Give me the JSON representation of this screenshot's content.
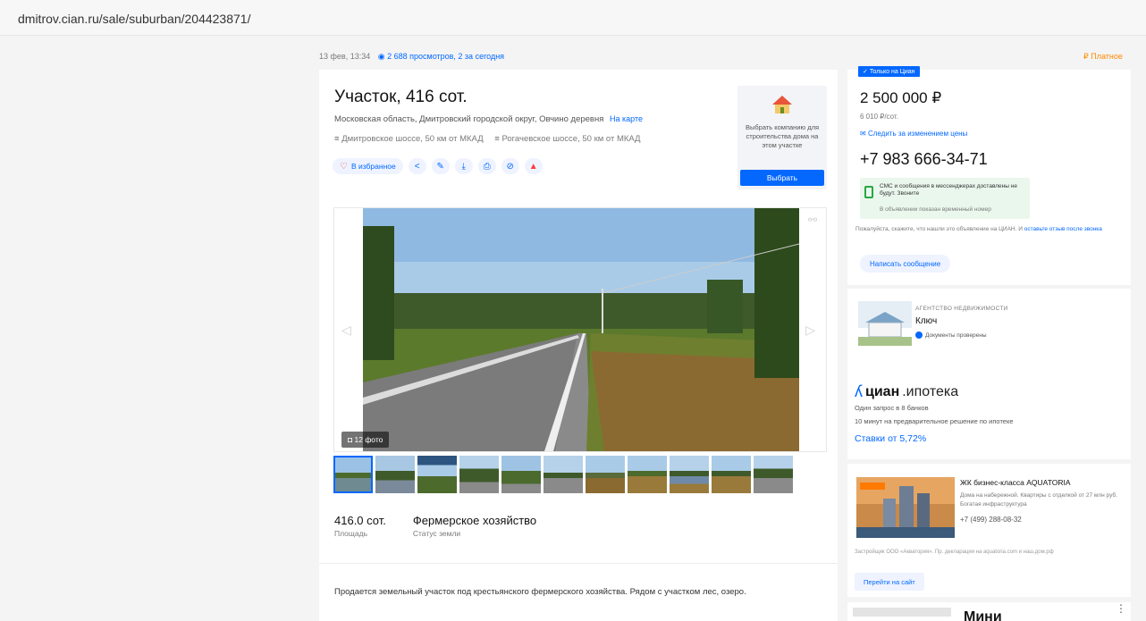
{
  "browser": {
    "url": "dmitrov.cian.ru/sale/suburban/204423871/"
  },
  "meta": {
    "date": "13 фев, 13:34",
    "views": "2 688 просмотров, 2 за сегодня",
    "paid": "₽ Платное"
  },
  "listing": {
    "title": "Участок, 416 сот.",
    "address": "Московская область, Дмитровский городской округ, Овчино деревня",
    "map_link": "На карте",
    "highways": [
      "Дмитровское шоссе, 50 км от МКАД",
      "Рогачевское шоссе, 50 км от МКАД"
    ],
    "favorite_label": "В избранное",
    "action_icons": [
      "share-icon",
      "edit-icon",
      "download-icon",
      "print-icon",
      "hide-icon",
      "report-icon"
    ],
    "builder": {
      "text": "Выбрать компанию для строительства дома на этом участке",
      "button": "Выбрать"
    },
    "photo_count": "12 фото",
    "facts": [
      {
        "value": "416.0 сот.",
        "label": "Площадь"
      },
      {
        "value": "Фермерское хозяйство",
        "label": "Статус земли"
      }
    ],
    "description": "Продается земельный участок под крестьянского фермерского хозяйства. Рядом с участком лес, озеро."
  },
  "offer": {
    "badge": "Только на Циан",
    "price": "2 500 000 ₽",
    "price_per_unit": "6 010 ₽/сот.",
    "follow_price": "Следить за изменением цены",
    "phone": "+7 983 666-34-71",
    "sms_note": "СМС и сообщения в мессенджерах доставлены не будут. Звоните",
    "temp_number_note": "В объявлении показан временный номер",
    "cian_note": "Пожалуйста, скажите, что нашли это объявление на ЦИАН. И",
    "cian_note_link": "оставьте отзыв после звонка",
    "message_button": "Написать сообщение"
  },
  "agency": {
    "type": "АГЕНТСТВО НЕДВИЖИМОСТИ",
    "name": "Ключ",
    "verified": "Документы проверены"
  },
  "mortgage": {
    "logo_bold": "циан",
    "logo_rest": ".ипотека",
    "line1": "Один запрос в 8 банков",
    "line2": "10 минут на предварительное решение по ипотеке",
    "rates": "Ставки от 5,72%"
  },
  "ad": {
    "title": "ЖК бизнес-класса AQUATORIA",
    "desc": "Дома на набережной. Квартиры с отделкой от 27 млн руб. Богатая инфраструктура",
    "phone": "+7 (499) 288-08-32",
    "footer": "Застройщик ООО «Акватория». Пр. декларация на aquatoria.com и наш.дом.рф",
    "button": "Перейти на сайт"
  },
  "ad2": {
    "title": "Мини"
  },
  "colors": {
    "accent": "#0468ff",
    "paid": "#ff8a00",
    "danger": "#ff3b3b",
    "success": "#27a844"
  }
}
